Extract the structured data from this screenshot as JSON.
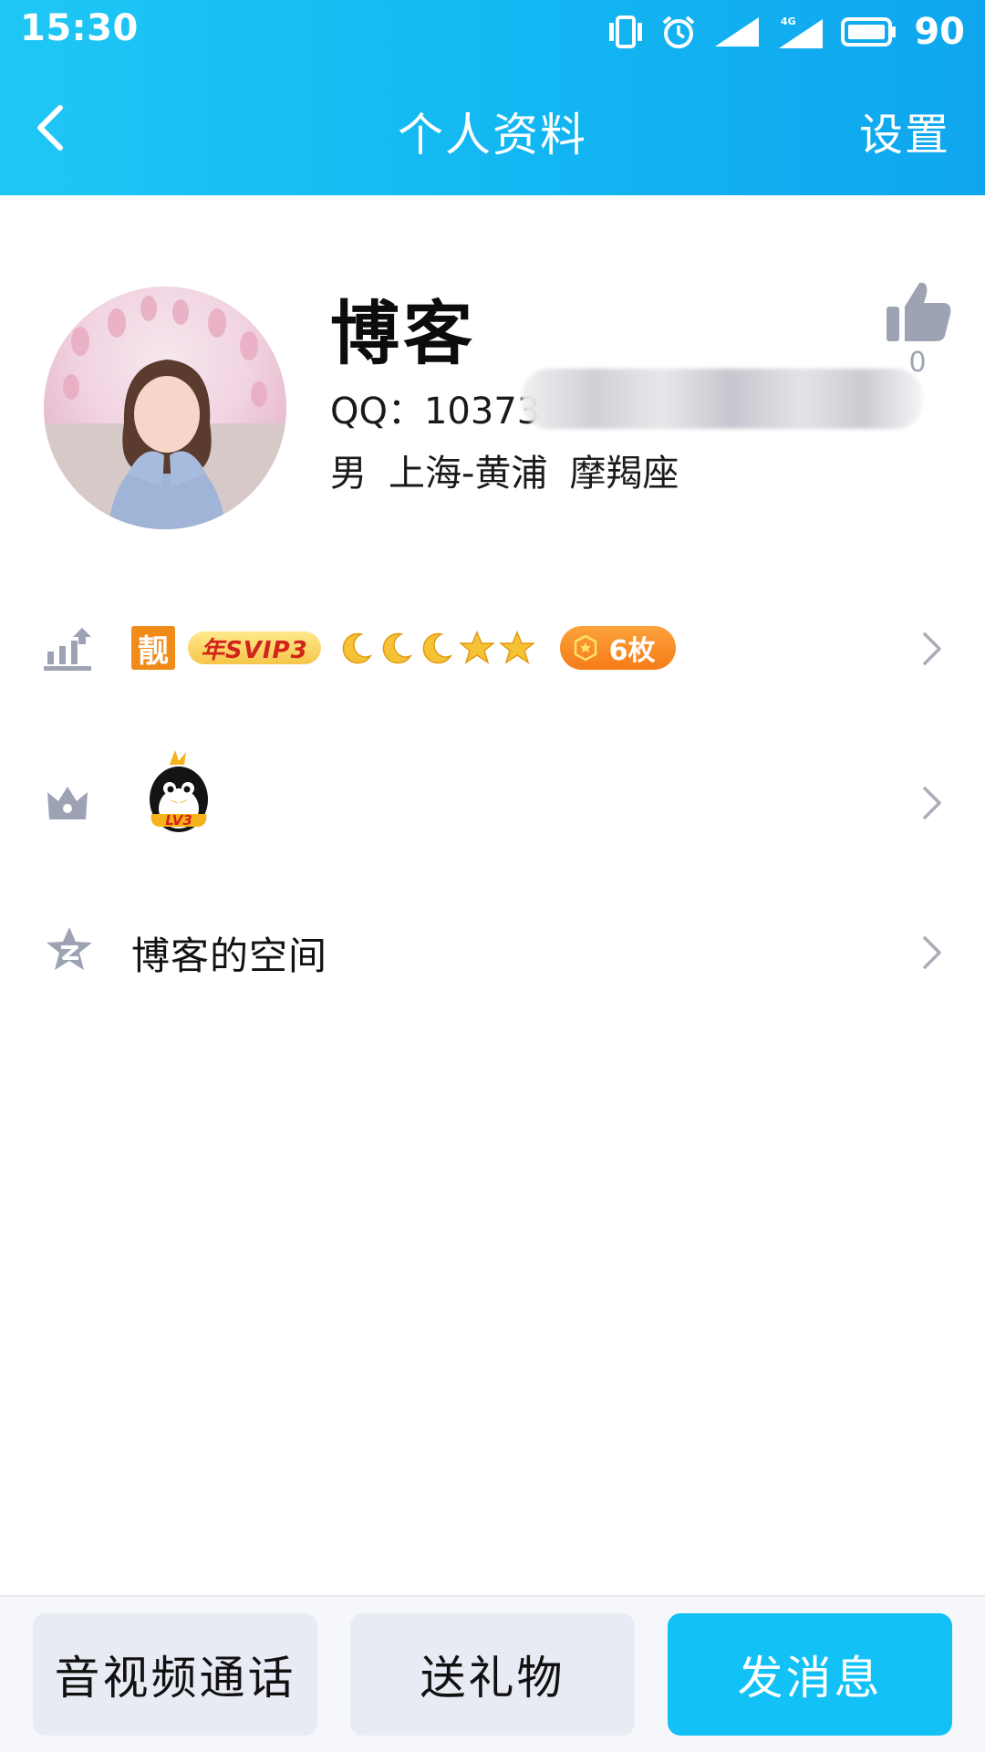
{
  "status_bar": {
    "time": "15:30",
    "network": "4G",
    "battery_level": "90",
    "icons": [
      "vibrate-icon",
      "alarm-icon",
      "signal-icon",
      "4g-signal-icon",
      "battery-icon"
    ]
  },
  "nav": {
    "back_icon": "chevron-left-icon",
    "title": "个人资料",
    "settings_label": "设置"
  },
  "profile": {
    "name": "博客",
    "qq_label": "QQ：10373",
    "gender": "男",
    "location": "上海-黄浦",
    "zodiac": "摩羯座",
    "like_count": "0"
  },
  "vip_row": {
    "icon": "level-up-icon",
    "liang_badge": "靓",
    "svip_badge": "年SVIP3",
    "level_icons": [
      "moon",
      "moon",
      "moon",
      "star",
      "star"
    ],
    "medal_count": "6枚"
  },
  "game_row": {
    "icon": "crown-icon",
    "penguin_badge": "LV3"
  },
  "space_row": {
    "icon": "qzone-star-icon",
    "label": "博客的空间"
  },
  "bottom_bar": {
    "call_label": "音视频通话",
    "gift_label": "送礼物",
    "message_label": "发消息"
  },
  "colors": {
    "header_start": "#1fc7f5",
    "header_end": "#10a6ee",
    "primary_button": "#12c1f5",
    "medal_orange": "#f57c19",
    "icon_gray": "#9ea3b4"
  }
}
